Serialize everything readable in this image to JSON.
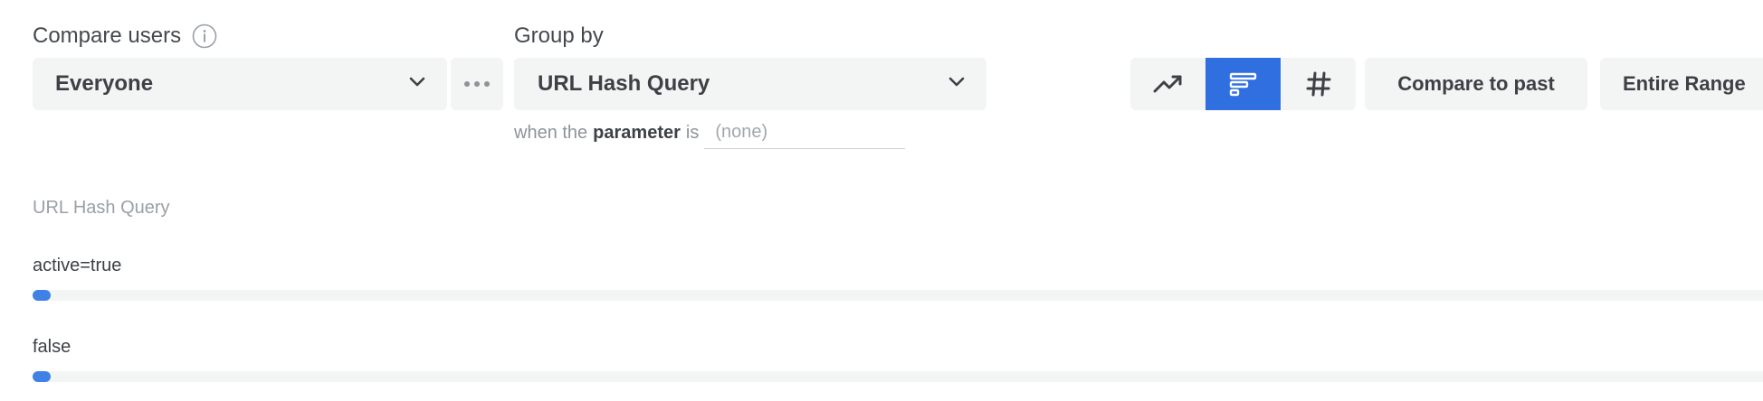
{
  "compare": {
    "label": "Compare users",
    "selected": "Everyone"
  },
  "group_by": {
    "label": "Group by",
    "selected": "URL Hash Query",
    "when_the": "when the",
    "parameter": "parameter",
    "is": "is",
    "parameter_placeholder": "(none)"
  },
  "toolbar": {
    "compare_past_label": "Compare to past",
    "range_label": "Entire Range",
    "active_view": "bar"
  },
  "results": {
    "title": "URL Hash Query",
    "rows": [
      {
        "label": "active=true",
        "fraction": 0.01
      },
      {
        "label": "false",
        "fraction": 0.01
      }
    ]
  },
  "colors": {
    "accent": "#2f6fe0",
    "bar": "#3f82e6",
    "control_bg": "#f3f4f4"
  }
}
